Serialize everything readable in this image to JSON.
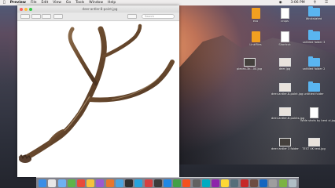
{
  "menubar": {
    "apple": "",
    "app_name": "Preview",
    "items": [
      "File",
      "Edit",
      "View",
      "Go",
      "Tools",
      "Window",
      "Help"
    ],
    "clock": "3:06 PM",
    "user": "Sun 1:02 AM"
  },
  "window": {
    "title": "deer-antler-8-point.jpg",
    "search_placeholder": "Search"
  },
  "desktop_icons": [
    {
      "label": "eco",
      "kind": "zip"
    },
    {
      "label": "crops",
      "kind": "doc"
    },
    {
      "label": "Wrokstated",
      "kind": "folder"
    },
    {
      "label": "LinkFiles",
      "kind": "zip"
    },
    {
      "label": "Shortcut",
      "kind": "doc"
    },
    {
      "label": "untitled folder 3",
      "kind": "folder"
    },
    {
      "label": "piecex-3k...00.jpg",
      "kind": "thumb-dark"
    },
    {
      "label": "deer.jpg",
      "kind": "thumb"
    },
    {
      "label": "untitled folder 2",
      "kind": "folder"
    },
    {
      "label": "deer-antler-8-point.jpg",
      "kind": "thumb"
    },
    {
      "label": "untitled folder",
      "kind": "folder"
    },
    {
      "label": "deer-antler-8-points.jpg",
      "kind": "thumb"
    },
    {
      "label": "Wide shots by best xi.jpg",
      "kind": "doc"
    },
    {
      "label": "deer antler 3 folder",
      "kind": "thumb-dark"
    },
    {
      "label": "TEST 4K test.jpg",
      "kind": "thumb"
    }
  ],
  "dock": {
    "colors": [
      "#3a8ee6",
      "#e7e7e7",
      "#6fb1f2",
      "#5fb34a",
      "#e84a3b",
      "#f5c23b",
      "#9b59d0",
      "#e8762c",
      "#4aa3df",
      "#2f2f2f",
      "#27a4dd",
      "#d64040",
      "#3b3b3b",
      "#1e88e5",
      "#43a047",
      "#f4511e",
      "#616161",
      "#00acc1",
      "#8e24aa",
      "#fdd835",
      "#546e7a",
      "#c62828",
      "#6d4c41",
      "#1565c0",
      "#9e9e9e",
      "#7cb342",
      "#b0bec5"
    ]
  }
}
